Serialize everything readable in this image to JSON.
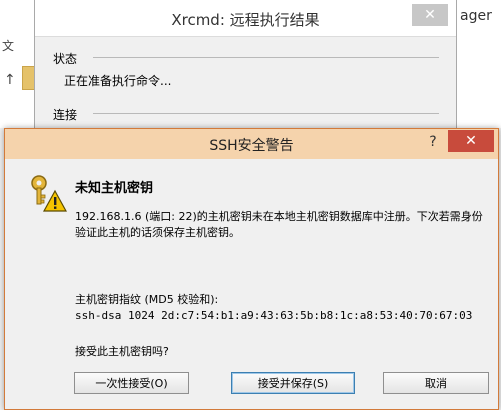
{
  "background_left": {
    "char": "文",
    "arrow": "↑"
  },
  "background_right": {
    "text": "ager"
  },
  "bg_window": {
    "title": "Xrcmd: 远程执行结果",
    "close_label": "✕",
    "status_section": "状态",
    "status_text": "正在准备执行命令...",
    "connect_section": "连接"
  },
  "dialog": {
    "title": "SSH安全警告",
    "help_label": "?",
    "close_label": "✕",
    "heading": "未知主机密钥",
    "message": "192.168.1.6 (端口: 22)的主机密钥未在本地主机密钥数据库中注册。下次若需身份验证此主机的话须保存主机密钥。",
    "fingerprint_label": "主机密钥指纹 (MD5 校验和):",
    "fingerprint_value": "ssh-dsa 1024 2d:c7:54:b1:a9:43:63:5b:b8:1c:a8:53:40:70:67:03",
    "question": "接受此主机密钥吗?",
    "buttons": {
      "accept_once": "一次性接受(O)",
      "accept_save": "接受并保存(S)",
      "cancel": "取消"
    }
  },
  "colors": {
    "title_bar": "#f5d3ac",
    "close_red": "#c84b3c"
  }
}
